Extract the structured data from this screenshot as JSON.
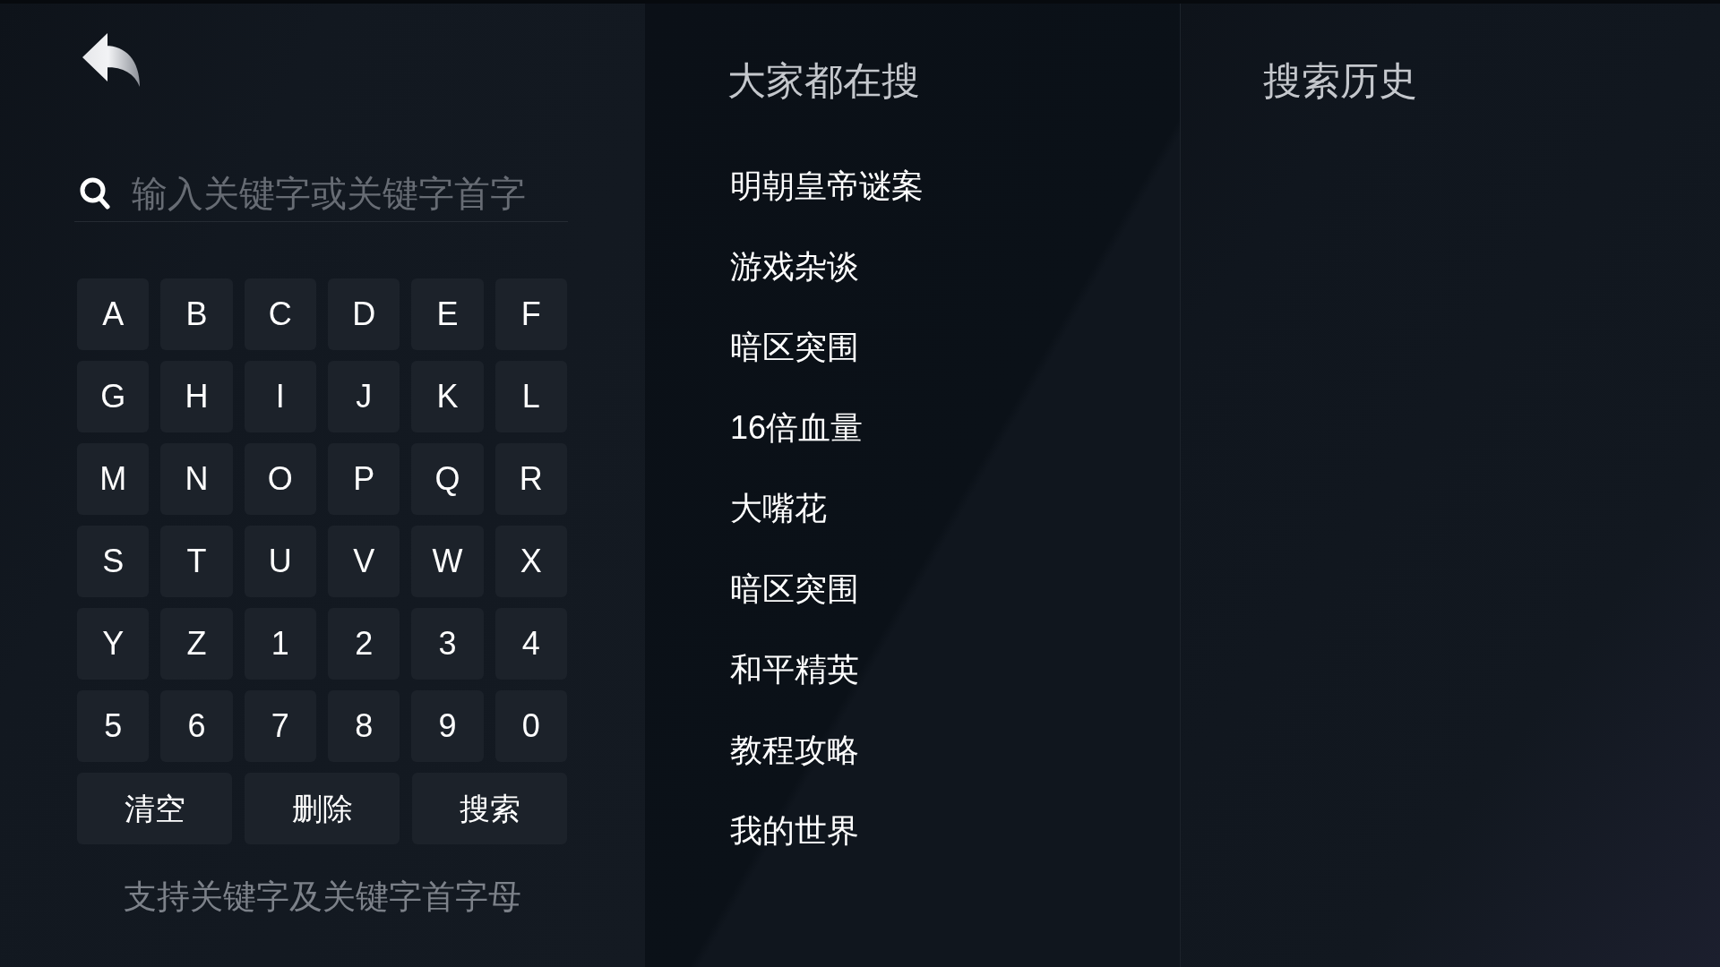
{
  "search": {
    "placeholder": "输入关键字或关键字首字"
  },
  "keyboard": {
    "keys": [
      "A",
      "B",
      "C",
      "D",
      "E",
      "F",
      "G",
      "H",
      "I",
      "J",
      "K",
      "L",
      "M",
      "N",
      "O",
      "P",
      "Q",
      "R",
      "S",
      "T",
      "U",
      "V",
      "W",
      "X",
      "Y",
      "Z",
      "1",
      "2",
      "3",
      "4",
      "5",
      "6",
      "7",
      "8",
      "9",
      "0"
    ],
    "actions": [
      "清空",
      "删除",
      "搜索"
    ]
  },
  "hint": "支持关键字及关键字首字母",
  "popular": {
    "title": "大家都在搜",
    "items": [
      "明朝皇帝谜案",
      "游戏杂谈",
      "暗区突围",
      "16倍血量",
      "大嘴花",
      "暗区突围",
      "和平精英",
      "教程攻略",
      "我的世界"
    ]
  },
  "history": {
    "title": "搜索历史"
  }
}
